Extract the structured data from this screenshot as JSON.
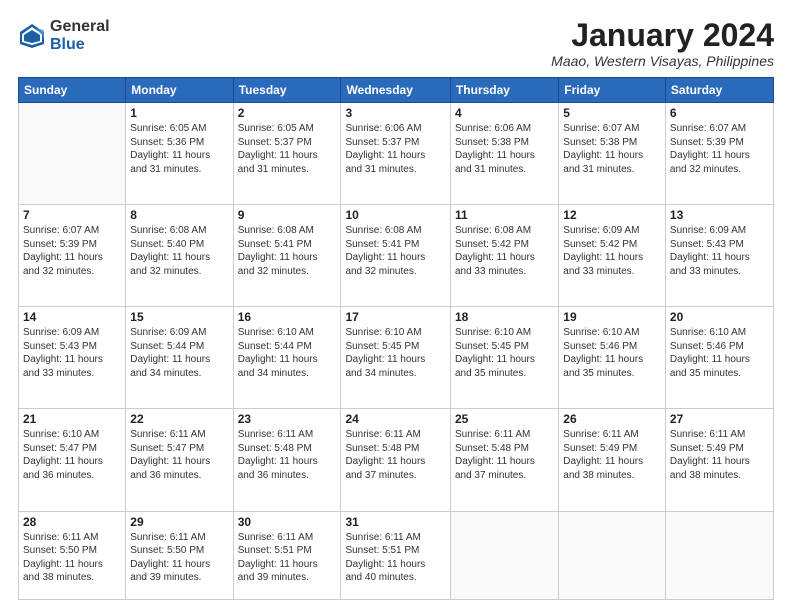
{
  "header": {
    "logo_general": "General",
    "logo_blue": "Blue",
    "month_title": "January 2024",
    "location": "Maao, Western Visayas, Philippines"
  },
  "days_of_week": [
    "Sunday",
    "Monday",
    "Tuesday",
    "Wednesday",
    "Thursday",
    "Friday",
    "Saturday"
  ],
  "weeks": [
    [
      {
        "num": "",
        "text": ""
      },
      {
        "num": "1",
        "text": "Sunrise: 6:05 AM\nSunset: 5:36 PM\nDaylight: 11 hours\nand 31 minutes."
      },
      {
        "num": "2",
        "text": "Sunrise: 6:05 AM\nSunset: 5:37 PM\nDaylight: 11 hours\nand 31 minutes."
      },
      {
        "num": "3",
        "text": "Sunrise: 6:06 AM\nSunset: 5:37 PM\nDaylight: 11 hours\nand 31 minutes."
      },
      {
        "num": "4",
        "text": "Sunrise: 6:06 AM\nSunset: 5:38 PM\nDaylight: 11 hours\nand 31 minutes."
      },
      {
        "num": "5",
        "text": "Sunrise: 6:07 AM\nSunset: 5:38 PM\nDaylight: 11 hours\nand 31 minutes."
      },
      {
        "num": "6",
        "text": "Sunrise: 6:07 AM\nSunset: 5:39 PM\nDaylight: 11 hours\nand 32 minutes."
      }
    ],
    [
      {
        "num": "7",
        "text": "Sunrise: 6:07 AM\nSunset: 5:39 PM\nDaylight: 11 hours\nand 32 minutes."
      },
      {
        "num": "8",
        "text": "Sunrise: 6:08 AM\nSunset: 5:40 PM\nDaylight: 11 hours\nand 32 minutes."
      },
      {
        "num": "9",
        "text": "Sunrise: 6:08 AM\nSunset: 5:41 PM\nDaylight: 11 hours\nand 32 minutes."
      },
      {
        "num": "10",
        "text": "Sunrise: 6:08 AM\nSunset: 5:41 PM\nDaylight: 11 hours\nand 32 minutes."
      },
      {
        "num": "11",
        "text": "Sunrise: 6:08 AM\nSunset: 5:42 PM\nDaylight: 11 hours\nand 33 minutes."
      },
      {
        "num": "12",
        "text": "Sunrise: 6:09 AM\nSunset: 5:42 PM\nDaylight: 11 hours\nand 33 minutes."
      },
      {
        "num": "13",
        "text": "Sunrise: 6:09 AM\nSunset: 5:43 PM\nDaylight: 11 hours\nand 33 minutes."
      }
    ],
    [
      {
        "num": "14",
        "text": "Sunrise: 6:09 AM\nSunset: 5:43 PM\nDaylight: 11 hours\nand 33 minutes."
      },
      {
        "num": "15",
        "text": "Sunrise: 6:09 AM\nSunset: 5:44 PM\nDaylight: 11 hours\nand 34 minutes."
      },
      {
        "num": "16",
        "text": "Sunrise: 6:10 AM\nSunset: 5:44 PM\nDaylight: 11 hours\nand 34 minutes."
      },
      {
        "num": "17",
        "text": "Sunrise: 6:10 AM\nSunset: 5:45 PM\nDaylight: 11 hours\nand 34 minutes."
      },
      {
        "num": "18",
        "text": "Sunrise: 6:10 AM\nSunset: 5:45 PM\nDaylight: 11 hours\nand 35 minutes."
      },
      {
        "num": "19",
        "text": "Sunrise: 6:10 AM\nSunset: 5:46 PM\nDaylight: 11 hours\nand 35 minutes."
      },
      {
        "num": "20",
        "text": "Sunrise: 6:10 AM\nSunset: 5:46 PM\nDaylight: 11 hours\nand 35 minutes."
      }
    ],
    [
      {
        "num": "21",
        "text": "Sunrise: 6:10 AM\nSunset: 5:47 PM\nDaylight: 11 hours\nand 36 minutes."
      },
      {
        "num": "22",
        "text": "Sunrise: 6:11 AM\nSunset: 5:47 PM\nDaylight: 11 hours\nand 36 minutes."
      },
      {
        "num": "23",
        "text": "Sunrise: 6:11 AM\nSunset: 5:48 PM\nDaylight: 11 hours\nand 36 minutes."
      },
      {
        "num": "24",
        "text": "Sunrise: 6:11 AM\nSunset: 5:48 PM\nDaylight: 11 hours\nand 37 minutes."
      },
      {
        "num": "25",
        "text": "Sunrise: 6:11 AM\nSunset: 5:48 PM\nDaylight: 11 hours\nand 37 minutes."
      },
      {
        "num": "26",
        "text": "Sunrise: 6:11 AM\nSunset: 5:49 PM\nDaylight: 11 hours\nand 38 minutes."
      },
      {
        "num": "27",
        "text": "Sunrise: 6:11 AM\nSunset: 5:49 PM\nDaylight: 11 hours\nand 38 minutes."
      }
    ],
    [
      {
        "num": "28",
        "text": "Sunrise: 6:11 AM\nSunset: 5:50 PM\nDaylight: 11 hours\nand 38 minutes."
      },
      {
        "num": "29",
        "text": "Sunrise: 6:11 AM\nSunset: 5:50 PM\nDaylight: 11 hours\nand 39 minutes."
      },
      {
        "num": "30",
        "text": "Sunrise: 6:11 AM\nSunset: 5:51 PM\nDaylight: 11 hours\nand 39 minutes."
      },
      {
        "num": "31",
        "text": "Sunrise: 6:11 AM\nSunset: 5:51 PM\nDaylight: 11 hours\nand 40 minutes."
      },
      {
        "num": "",
        "text": ""
      },
      {
        "num": "",
        "text": ""
      },
      {
        "num": "",
        "text": ""
      }
    ]
  ]
}
